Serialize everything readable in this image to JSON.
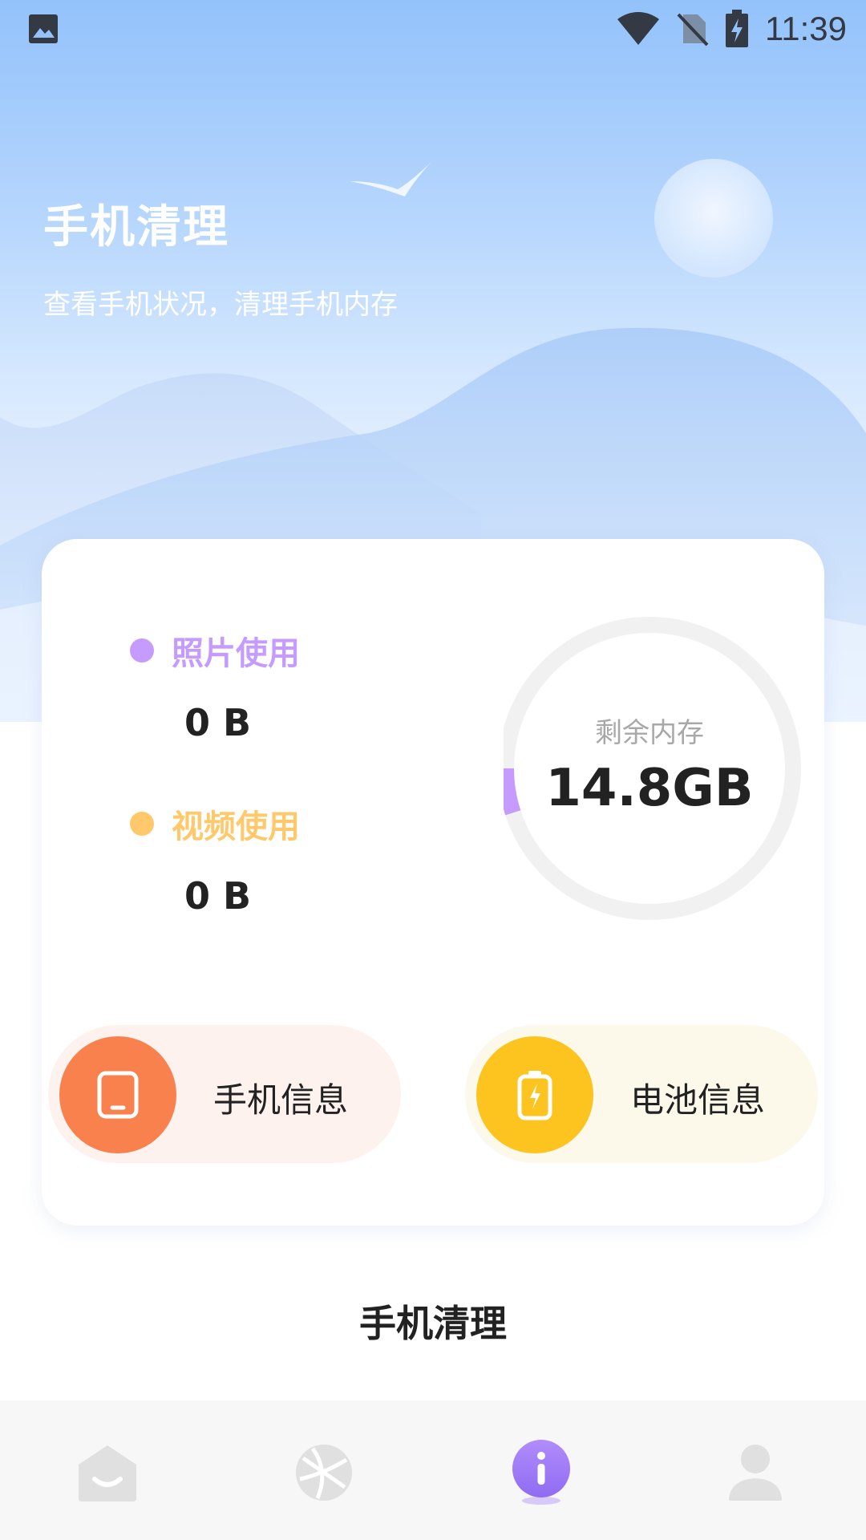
{
  "status_bar": {
    "time": "11:39",
    "icons": [
      "image-icon",
      "wifi-icon",
      "no-sim-icon",
      "battery-charging-icon"
    ]
  },
  "header": {
    "title": "手机清理",
    "subtitle": "查看手机状况，清理手机内存"
  },
  "storage": {
    "photos": {
      "label": "照片使用",
      "value": "0 B",
      "color": "#c59bff"
    },
    "videos": {
      "label": "视频使用",
      "value": "0 B",
      "color": "#ffc86b"
    },
    "remaining": {
      "label": "剩余内存",
      "value": "14.8GB",
      "used_fraction": 0.05,
      "accent": "#c59bff"
    }
  },
  "actions": {
    "phone_info": {
      "label": "手机信息",
      "icon": "phone-icon",
      "color": "#f8814e",
      "bg": "#fef2ee"
    },
    "battery_info": {
      "label": "电池信息",
      "icon": "battery-icon",
      "color": "#fdc31e",
      "bg": "#fcf9ea"
    }
  },
  "section_title": "手机清理",
  "bottom_nav": {
    "items": [
      {
        "icon": "home-icon",
        "active": false
      },
      {
        "icon": "globe-icon",
        "active": false
      },
      {
        "icon": "info-icon",
        "active": true
      },
      {
        "icon": "user-icon",
        "active": false
      }
    ],
    "active_color": "#a07cf7"
  }
}
